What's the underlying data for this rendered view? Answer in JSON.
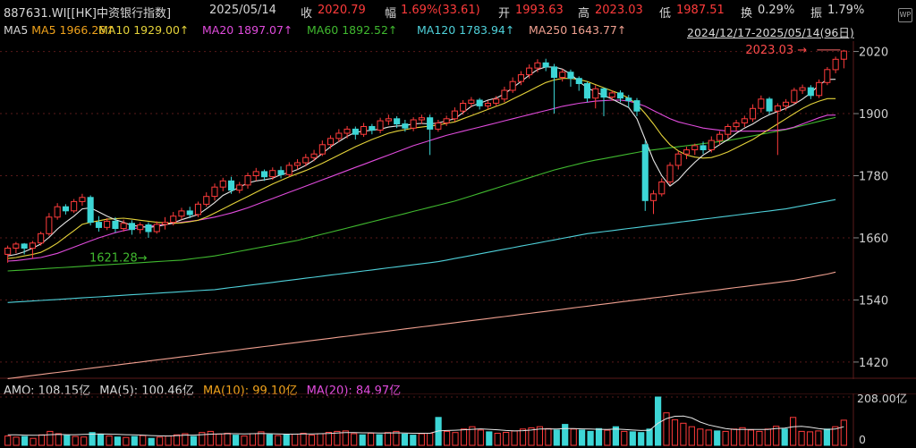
{
  "header": {
    "code": "887631.WI[[HK]中资银行指数]",
    "date": "2025/05/14",
    "close_label": "收",
    "close": "2020.79",
    "chg_label": "幅",
    "chg": "1.69%(33.61)",
    "open_label": "开",
    "open": "1993.63",
    "high_label": "高",
    "high": "2023.03",
    "low_label": "低",
    "low": "1987.51",
    "turnover_label": "换",
    "turnover": "0.29%",
    "amp_label": "振",
    "amp": "1.79%",
    "icon": "wp-icon"
  },
  "ma_row": {
    "ma5": "MA5  1966.26↑",
    "ma10": "MA10  1929.00↑",
    "ma20": "MA20  1897.07↑",
    "ma60": "MA60  1892.52↑",
    "ma120": "MA120  1783.94↑",
    "ma250": "MA250  1643.77↑",
    "range": "2024/12/17-2025/05/14(96日)",
    "settings_icon": "gear-icon",
    "dropdown_icon": "chevron-down-icon"
  },
  "volume_row": {
    "amo": "AMO: 108.15亿",
    "ma5": "MA(5): 100.46亿",
    "ma10": "MA(10): 99.10亿",
    "ma20": "MA(20): 84.97亿"
  },
  "colors": {
    "up": "#ff3b3b",
    "down": "#3dd6d6",
    "ma5": "#e6e6e6",
    "ma10": "#e5d33a",
    "ma20": "#e04bdc",
    "ma60": "#40b92f",
    "ma120": "#4fd1da",
    "ma250": "#f0a090",
    "grid": "#5a1a1a"
  },
  "chart_data": {
    "type": "candlestick",
    "y_ticks": [
      2020,
      1900,
      1780,
      1660,
      1540,
      1420
    ],
    "ylim": [
      1387,
      2040
    ],
    "max_label": "2023.03",
    "min_label": "1621.28",
    "candles": [
      [
        1628,
        1640,
        1612,
        1645
      ],
      [
        1640,
        1648,
        1630,
        1652
      ],
      [
        1648,
        1640,
        1628,
        1650
      ],
      [
        1640,
        1650,
        1620,
        1654
      ],
      [
        1650,
        1668,
        1645,
        1672
      ],
      [
        1668,
        1700,
        1664,
        1708
      ],
      [
        1700,
        1720,
        1695,
        1727
      ],
      [
        1720,
        1712,
        1705,
        1725
      ],
      [
        1712,
        1730,
        1708,
        1735
      ],
      [
        1730,
        1738,
        1722,
        1745
      ],
      [
        1738,
        1690,
        1684,
        1742
      ],
      [
        1690,
        1680,
        1672,
        1702
      ],
      [
        1680,
        1692,
        1675,
        1698
      ],
      [
        1692,
        1678,
        1670,
        1700
      ],
      [
        1678,
        1688,
        1672,
        1695
      ],
      [
        1688,
        1676,
        1666,
        1694
      ],
      [
        1676,
        1685,
        1668,
        1690
      ],
      [
        1685,
        1672,
        1660,
        1690
      ],
      [
        1672,
        1686,
        1668,
        1692
      ],
      [
        1686,
        1690,
        1676,
        1700
      ],
      [
        1690,
        1702,
        1684,
        1710
      ],
      [
        1702,
        1712,
        1695,
        1718
      ],
      [
        1712,
        1705,
        1698,
        1720
      ],
      [
        1705,
        1725,
        1700,
        1730
      ],
      [
        1725,
        1740,
        1720,
        1748
      ],
      [
        1740,
        1758,
        1732,
        1765
      ],
      [
        1758,
        1770,
        1750,
        1776
      ],
      [
        1770,
        1752,
        1745,
        1778
      ],
      [
        1752,
        1762,
        1746,
        1768
      ],
      [
        1762,
        1780,
        1755,
        1786
      ],
      [
        1780,
        1788,
        1770,
        1795
      ],
      [
        1788,
        1778,
        1770,
        1792
      ],
      [
        1778,
        1790,
        1772,
        1796
      ],
      [
        1790,
        1782,
        1775,
        1798
      ],
      [
        1782,
        1800,
        1778,
        1806
      ],
      [
        1800,
        1805,
        1792,
        1812
      ],
      [
        1805,
        1815,
        1798,
        1822
      ],
      [
        1815,
        1822,
        1808,
        1830
      ],
      [
        1822,
        1840,
        1818,
        1848
      ],
      [
        1840,
        1852,
        1832,
        1858
      ],
      [
        1852,
        1862,
        1845,
        1870
      ],
      [
        1862,
        1870,
        1852,
        1876
      ],
      [
        1870,
        1860,
        1850,
        1875
      ],
      [
        1860,
        1875,
        1855,
        1882
      ],
      [
        1875,
        1868,
        1860,
        1880
      ],
      [
        1868,
        1886,
        1862,
        1892
      ],
      [
        1886,
        1890,
        1878,
        1898
      ],
      [
        1890,
        1880,
        1872,
        1895
      ],
      [
        1880,
        1872,
        1865,
        1888
      ],
      [
        1872,
        1888,
        1866,
        1893
      ],
      [
        1888,
        1892,
        1880,
        1898
      ],
      [
        1892,
        1870,
        1820,
        1898
      ],
      [
        1870,
        1882,
        1865,
        1888
      ],
      [
        1882,
        1890,
        1876,
        1896
      ],
      [
        1890,
        1905,
        1884,
        1912
      ],
      [
        1905,
        1920,
        1898,
        1926
      ],
      [
        1920,
        1926,
        1912,
        1932
      ],
      [
        1926,
        1915,
        1908,
        1930
      ],
      [
        1915,
        1920,
        1908,
        1925
      ],
      [
        1920,
        1928,
        1914,
        1934
      ],
      [
        1928,
        1945,
        1922,
        1952
      ],
      [
        1945,
        1962,
        1940,
        1970
      ],
      [
        1962,
        1975,
        1955,
        1982
      ],
      [
        1975,
        1988,
        1968,
        1995
      ],
      [
        1988,
        1998,
        1980,
        2005
      ],
      [
        1998,
        1990,
        1982,
        2006
      ],
      [
        1990,
        1970,
        1900,
        1996
      ],
      [
        1970,
        1980,
        1962,
        1986
      ],
      [
        1980,
        1968,
        1952,
        1985
      ],
      [
        1968,
        1958,
        1944,
        1972
      ],
      [
        1958,
        1930,
        1922,
        1962
      ],
      [
        1930,
        1948,
        1910,
        1955
      ],
      [
        1948,
        1932,
        1895,
        1950
      ],
      [
        1932,
        1940,
        1925,
        1945
      ],
      [
        1940,
        1930,
        1922,
        1945
      ],
      [
        1930,
        1925,
        1912,
        1936
      ],
      [
        1925,
        1905,
        1895,
        1930
      ],
      [
        1840,
        1732,
        1712,
        1848
      ],
      [
        1732,
        1745,
        1706,
        1752
      ],
      [
        1745,
        1768,
        1740,
        1775
      ],
      [
        1768,
        1800,
        1762,
        1806
      ],
      [
        1800,
        1822,
        1792,
        1828
      ],
      [
        1822,
        1830,
        1812,
        1836
      ],
      [
        1830,
        1838,
        1820,
        1842
      ],
      [
        1838,
        1830,
        1822,
        1846
      ],
      [
        1830,
        1848,
        1825,
        1856
      ],
      [
        1848,
        1860,
        1840,
        1866
      ],
      [
        1860,
        1875,
        1852,
        1880
      ],
      [
        1875,
        1882,
        1866,
        1888
      ],
      [
        1882,
        1890,
        1874,
        1896
      ],
      [
        1890,
        1910,
        1884,
        1918
      ],
      [
        1910,
        1928,
        1902,
        1935
      ],
      [
        1928,
        1905,
        1898,
        1932
      ],
      [
        1905,
        1915,
        1820,
        1920
      ],
      [
        1915,
        1922,
        1906,
        1928
      ],
      [
        1922,
        1945,
        1918,
        1950
      ],
      [
        1945,
        1950,
        1938,
        1956
      ],
      [
        1950,
        1935,
        1928,
        1955
      ],
      [
        1935,
        1960,
        1930,
        1966
      ],
      [
        1960,
        1985,
        1955,
        1990
      ],
      [
        1985,
        2005,
        1978,
        2010
      ],
      [
        2005,
        2020.79,
        1987.51,
        2023.03
      ]
    ],
    "ma5": [
      1625,
      1628,
      1633,
      1640,
      1648,
      1661,
      1677,
      1690,
      1702,
      1716,
      1718,
      1710,
      1702,
      1695,
      1690,
      1684,
      1682,
      1680,
      1682,
      1685,
      1689,
      1695,
      1700,
      1705,
      1716,
      1728,
      1742,
      1750,
      1758,
      1766,
      1770,
      1772,
      1775,
      1782,
      1786,
      1792,
      1800,
      1810,
      1823,
      1836,
      1846,
      1856,
      1864,
      1866,
      1868,
      1870,
      1874,
      1876,
      1877,
      1880,
      1881,
      1880,
      1882,
      1886,
      1890,
      1902,
      1914,
      1920,
      1926,
      1930,
      1938,
      1950,
      1962,
      1974,
      1985,
      1990,
      1990,
      1986,
      1976,
      1962,
      1950,
      1942,
      1935,
      1928,
      1920,
      1912,
      1890,
      1850,
      1810,
      1780,
      1760,
      1772,
      1790,
      1806,
      1820,
      1830,
      1840,
      1850,
      1862,
      1872,
      1880,
      1890,
      1898,
      1904,
      1910,
      1918,
      1928,
      1940,
      1955,
      1966,
      1966.26
    ],
    "ma10": [
      1620,
      1622,
      1625,
      1628,
      1632,
      1640,
      1650,
      1662,
      1674,
      1686,
      1690,
      1693,
      1696,
      1697,
      1698,
      1696,
      1694,
      1692,
      1690,
      1689,
      1688,
      1689,
      1691,
      1694,
      1700,
      1708,
      1716,
      1724,
      1732,
      1740,
      1748,
      1756,
      1764,
      1771,
      1778,
      1784,
      1790,
      1797,
      1804,
      1812,
      1820,
      1828,
      1836,
      1843,
      1850,
      1856,
      1862,
      1866,
      1869,
      1872,
      1874,
      1876,
      1878,
      1881,
      1884,
      1890,
      1896,
      1902,
      1908,
      1914,
      1920,
      1928,
      1936,
      1944,
      1952,
      1960,
      1965,
      1968,
      1968,
      1966,
      1962,
      1956,
      1950,
      1944,
      1938,
      1930,
      1918,
      1900,
      1880,
      1858,
      1840,
      1828,
      1820,
      1816,
      1814,
      1815,
      1820,
      1826,
      1834,
      1842,
      1850,
      1860,
      1870,
      1880,
      1890,
      1900,
      1910,
      1918,
      1924,
      1929,
      1929.0
    ],
    "ma20": [
      1615,
      1616,
      1618,
      1620,
      1622,
      1626,
      1630,
      1636,
      1642,
      1648,
      1654,
      1660,
      1665,
      1670,
      1674,
      1677,
      1680,
      1682,
      1684,
      1686,
      1688,
      1690,
      1692,
      1694,
      1697,
      1700,
      1704,
      1708,
      1713,
      1718,
      1724,
      1730,
      1736,
      1742,
      1748,
      1754,
      1760,
      1766,
      1772,
      1778,
      1784,
      1790,
      1796,
      1802,
      1808,
      1814,
      1820,
      1826,
      1832,
      1838,
      1843,
      1848,
      1853,
      1858,
      1862,
      1866,
      1870,
      1874,
      1878,
      1882,
      1886,
      1890,
      1894,
      1898,
      1902,
      1906,
      1910,
      1914,
      1917,
      1920,
      1922,
      1924,
      1925,
      1926,
      1926,
      1924,
      1920,
      1914,
      1906,
      1898,
      1890,
      1884,
      1880,
      1876,
      1872,
      1870,
      1868,
      1866,
      1866,
      1866,
      1866,
      1866,
      1867,
      1868,
      1870,
      1874,
      1880,
      1886,
      1892,
      1897,
      1897.07
    ],
    "ma60": [
      1596,
      1597,
      1598,
      1599,
      1600,
      1601,
      1602,
      1603,
      1604,
      1605,
      1606,
      1607,
      1608,
      1609,
      1610,
      1611,
      1612,
      1613,
      1614,
      1615,
      1616,
      1617,
      1619,
      1621,
      1623,
      1625,
      1628,
      1631,
      1634,
      1637,
      1640,
      1643,
      1646,
      1649,
      1652,
      1655,
      1659,
      1663,
      1667,
      1671,
      1675,
      1679,
      1683,
      1687,
      1691,
      1695,
      1699,
      1703,
      1707,
      1711,
      1715,
      1719,
      1723,
      1727,
      1731,
      1736,
      1741,
      1746,
      1751,
      1756,
      1761,
      1766,
      1771,
      1776,
      1781,
      1786,
      1791,
      1795,
      1799,
      1803,
      1807,
      1810,
      1813,
      1816,
      1819,
      1822,
      1825,
      1828,
      1830,
      1832,
      1834,
      1836,
      1838,
      1840,
      1842,
      1844,
      1846,
      1848,
      1851,
      1854,
      1857,
      1860,
      1863,
      1866,
      1869,
      1873,
      1877,
      1881,
      1885,
      1889,
      1892.52
    ],
    "ma120": [
      1535,
      1536,
      1537,
      1538,
      1539,
      1540,
      1541,
      1542,
      1543,
      1544,
      1545,
      1546,
      1547,
      1548,
      1549,
      1550,
      1551,
      1552,
      1553,
      1554,
      1555,
      1556,
      1557,
      1558,
      1559,
      1560,
      1562,
      1564,
      1566,
      1568,
      1570,
      1572,
      1574,
      1576,
      1578,
      1580,
      1582,
      1584,
      1586,
      1588,
      1590,
      1592,
      1594,
      1596,
      1598,
      1600,
      1602,
      1604,
      1606,
      1608,
      1610,
      1612,
      1614,
      1617,
      1620,
      1623,
      1626,
      1629,
      1632,
      1635,
      1638,
      1641,
      1644,
      1647,
      1650,
      1653,
      1656,
      1659,
      1662,
      1665,
      1668,
      1670,
      1672,
      1674,
      1676,
      1678,
      1680,
      1682,
      1684,
      1686,
      1688,
      1690,
      1692,
      1694,
      1696,
      1698,
      1700,
      1702,
      1704,
      1706,
      1708,
      1710,
      1712,
      1714,
      1716,
      1719,
      1722,
      1725,
      1728,
      1731,
      1733.94
    ],
    "ma250": [
      1388,
      1390,
      1392,
      1394,
      1396,
      1398,
      1400,
      1402,
      1404,
      1406,
      1408,
      1410,
      1412,
      1414,
      1416,
      1418,
      1420,
      1422,
      1424,
      1426,
      1428,
      1430,
      1432,
      1434,
      1436,
      1438,
      1440,
      1442,
      1444,
      1446,
      1448,
      1450,
      1452,
      1454,
      1456,
      1458,
      1460,
      1462,
      1464,
      1466,
      1468,
      1470,
      1472,
      1474,
      1476,
      1478,
      1480,
      1482,
      1484,
      1486,
      1488,
      1490,
      1492,
      1494,
      1496,
      1498,
      1500,
      1502,
      1504,
      1506,
      1508,
      1510,
      1512,
      1514,
      1516,
      1518,
      1520,
      1522,
      1524,
      1526,
      1528,
      1530,
      1532,
      1534,
      1536,
      1538,
      1540,
      1542,
      1544,
      1546,
      1548,
      1550,
      1552,
      1554,
      1556,
      1558,
      1560,
      1562,
      1564,
      1566,
      1568,
      1570,
      1572,
      1574,
      1576,
      1578,
      1581,
      1584,
      1587,
      1590,
      1593.77
    ],
    "volume": {
      "ylim": [
        0,
        208
      ],
      "y_ticks": [
        "208.00亿",
        "0"
      ],
      "values": [
        40,
        35,
        38,
        30,
        45,
        60,
        50,
        42,
        38,
        36,
        55,
        48,
        40,
        36,
        34,
        38,
        42,
        30,
        35,
        40,
        45,
        50,
        38,
        55,
        60,
        48,
        52,
        44,
        40,
        50,
        58,
        46,
        42,
        45,
        48,
        52,
        44,
        50,
        56,
        60,
        62,
        50,
        45,
        52,
        46,
        55,
        60,
        48,
        44,
        50,
        52,
        120,
        60,
        55,
        70,
        80,
        66,
        58,
        52,
        56,
        62,
        70,
        75,
        80,
        72,
        66,
        90,
        70,
        66,
        60,
        72,
        65,
        80,
        60,
        58,
        55,
        70,
        208,
        140,
        110,
        95,
        80,
        70,
        66,
        62,
        60,
        70,
        76,
        66,
        60,
        70,
        82,
        70,
        120,
        60,
        58,
        62,
        70,
        80,
        108.15
      ],
      "ma_line": [
        45,
        45,
        44,
        43,
        44,
        46,
        47,
        46,
        46,
        47,
        48,
        49,
        48,
        47,
        46,
        45,
        44,
        42,
        41,
        40,
        42,
        44,
        44,
        46,
        48,
        49,
        50,
        50,
        49,
        50,
        51,
        50,
        49,
        48,
        48,
        49,
        49,
        50,
        51,
        53,
        55,
        55,
        54,
        54,
        53,
        53,
        54,
        53,
        52,
        52,
        52,
        62,
        64,
        65,
        67,
        69,
        71,
        69,
        67,
        64,
        62,
        63,
        66,
        70,
        71,
        70,
        72,
        72,
        71,
        70,
        69,
        68,
        70,
        68,
        66,
        64,
        65,
        95,
        115,
        125,
        126,
        118,
        100,
        88,
        80,
        72,
        68,
        68,
        68,
        68,
        68,
        72,
        74,
        80,
        82,
        78,
        72,
        68,
        70,
        80,
        100.46
      ]
    }
  }
}
